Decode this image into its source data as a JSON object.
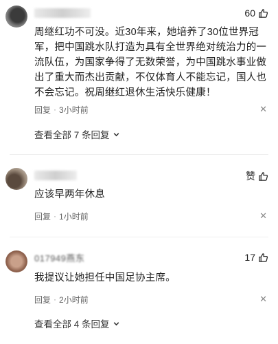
{
  "comments": [
    {
      "username": "",
      "likes": "60",
      "text": "周继红功不可没。近30年来，她培养了30位世界冠军，把中国跳水队打造为具有全世界绝对统治力的一流队伍，为国家争得了无数荣誉，为中国跳水事业做出了重大而杰出贡献，不仅体育人不能忘记，国人也不会忘记。祝周继红退休生活快乐健康！",
      "reply_label": "回复",
      "time": "3小时前",
      "view_replies": "查看全部 7 条回复"
    },
    {
      "username": "",
      "likes": "赞",
      "text": "应该早两年休息",
      "reply_label": "回复",
      "time": "1小时前"
    },
    {
      "username": "017949燕东",
      "likes": "17",
      "text": "我提议让她担任中国足协主席。",
      "reply_label": "回复",
      "time": "2小时前",
      "view_replies": "查看全部 4 条回复"
    }
  ],
  "icons": {
    "like": "thumbs-up-icon",
    "close": "close-icon",
    "expand": "chevron-down-icon"
  }
}
